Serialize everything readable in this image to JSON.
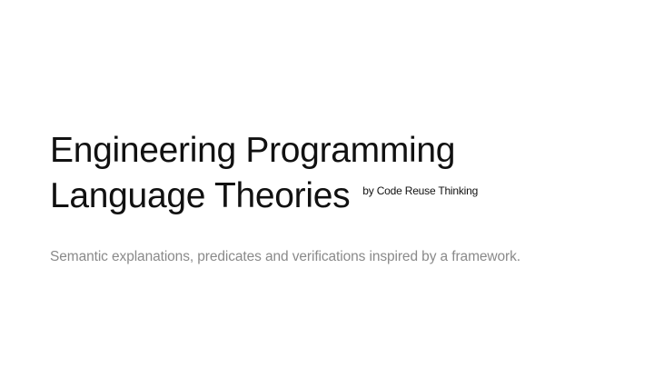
{
  "slide": {
    "title_line1": "Engineering Programming",
    "title_line2": "Language Theories",
    "byline": "by Code Reuse Thinking",
    "tagline": "Semantic explanations, predicates and verifications inspired by a framework."
  }
}
